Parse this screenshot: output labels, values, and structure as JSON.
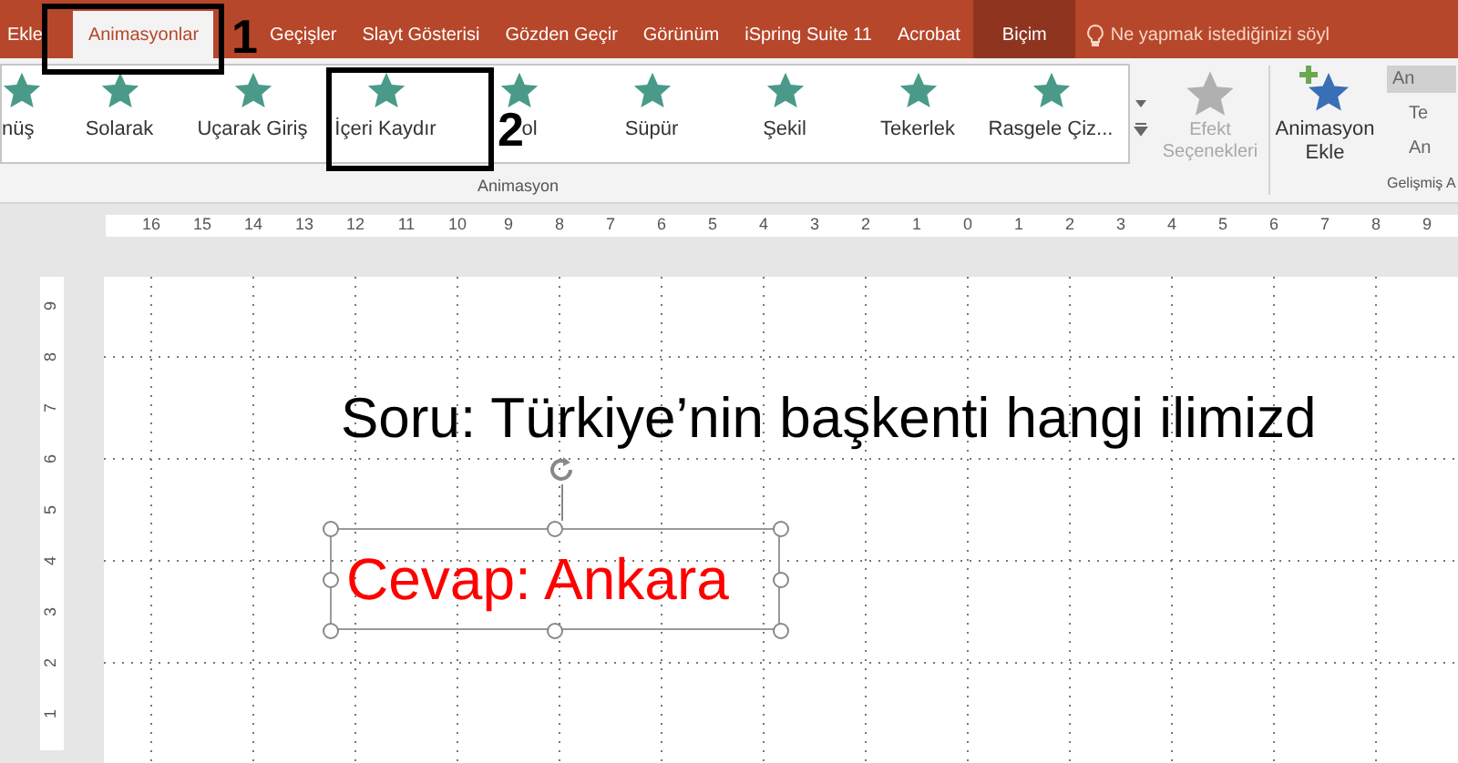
{
  "tabs": [
    {
      "label": "Ekle",
      "selected": false
    },
    {
      "label": "Animasyonlar",
      "selected": true
    },
    {
      "label": "Geçişler",
      "selected": false
    },
    {
      "label": "Slayt Gösterisi",
      "selected": false
    },
    {
      "label": "Gözden Geçir",
      "selected": false
    },
    {
      "label": "Görünüm",
      "selected": false
    },
    {
      "label": "iSpring Suite 11",
      "selected": false
    },
    {
      "label": "Acrobat",
      "selected": false
    },
    {
      "label": "Biçim",
      "selected": false,
      "kind": "context"
    }
  ],
  "tell_me": {
    "placeholder": "Ne yapmak istediğinizi söyl"
  },
  "animation_gallery": {
    "items": [
      {
        "label": "nüş"
      },
      {
        "label": "Solarak"
      },
      {
        "label": "Uçarak Giriş"
      },
      {
        "label": "İçeri Kaydır"
      },
      {
        "label": "ol"
      },
      {
        "label": "Süpür"
      },
      {
        "label": "Şekil"
      },
      {
        "label": "Tekerlek"
      },
      {
        "label": "Rasgele Çiz..."
      }
    ],
    "group_label": "Animasyon"
  },
  "effect_options": {
    "label": "Efekt Seçenekleri",
    "disabled": true
  },
  "add_animation": {
    "label": "Animasyon Ekle"
  },
  "advanced": {
    "items": [
      "An",
      "Te",
      "An"
    ],
    "group_label": "Gelişmiş A"
  },
  "ruler_horizontal": [
    "16",
    "15",
    "14",
    "13",
    "12",
    "11",
    "10",
    "9",
    "8",
    "7",
    "6",
    "5",
    "4",
    "3",
    "2",
    "1",
    "0",
    "1",
    "2",
    "3",
    "4",
    "5",
    "6",
    "7",
    "8",
    "9"
  ],
  "ruler_vertical": [
    "9",
    "8",
    "7",
    "6",
    "5",
    "4",
    "3",
    "2",
    "1"
  ],
  "slide": {
    "question": "Soru: Türkiye’nin başkenti hangi ilimizd",
    "answer": "Cevap: Ankara"
  },
  "annotations": [
    {
      "label": "1"
    },
    {
      "label": "2"
    }
  ]
}
